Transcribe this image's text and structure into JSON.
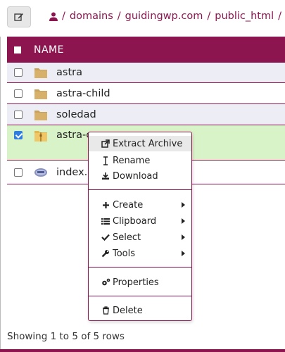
{
  "breadcrumb": {
    "items": [
      "domains",
      "guidingwp.com",
      "public_html"
    ],
    "separator": "/"
  },
  "table": {
    "header": "NAME",
    "rows": [
      {
        "name": "astra",
        "type": "folder",
        "checked": false
      },
      {
        "name": "astra-child",
        "type": "folder",
        "checked": false
      },
      {
        "name": "soledad",
        "type": "folder",
        "checked": false
      },
      {
        "name": "astra-c",
        "type": "archive",
        "checked": true
      },
      {
        "name": "index.p",
        "type": "php-file",
        "checked": false
      }
    ]
  },
  "context_menu": {
    "group1": [
      "Extract Archive",
      "Rename",
      "Download"
    ],
    "group2": [
      "Create",
      "Clipboard",
      "Select",
      "Tools"
    ],
    "group3": [
      "Properties"
    ],
    "group4": [
      "Delete"
    ]
  },
  "footer": {
    "status": "Showing 1 to 5 of 5 rows"
  },
  "colors": {
    "accent": "#8c1550",
    "selected_row": "#d8f3c8",
    "alt_row": "#edeef5",
    "folder": "#c8a25a"
  }
}
